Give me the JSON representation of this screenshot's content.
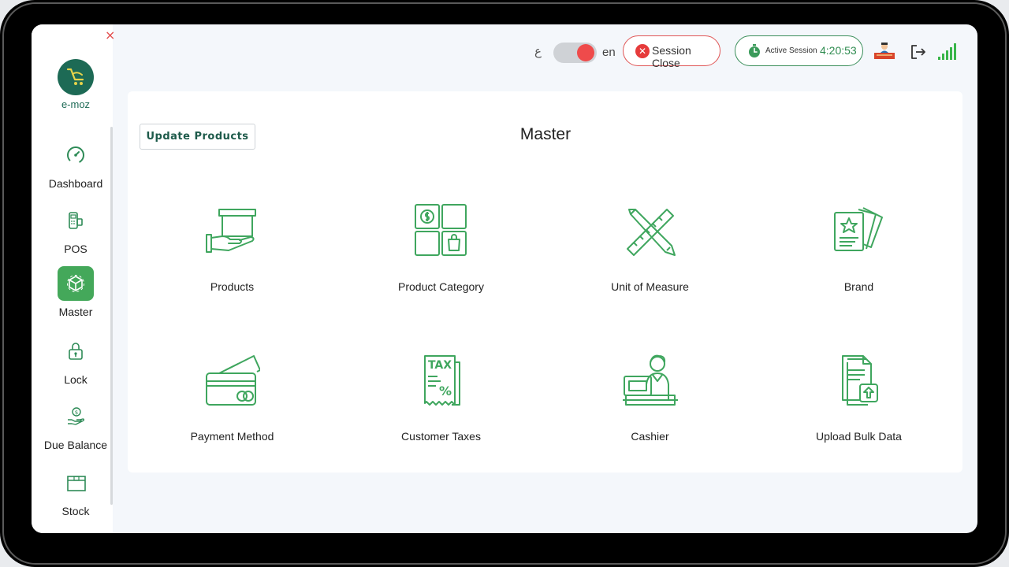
{
  "sidebar": {
    "close_glyph": "×",
    "logo_text": "e-moz",
    "items": [
      {
        "label": "Dashboard",
        "icon": "dashboard-gauge-icon"
      },
      {
        "label": "POS",
        "icon": "pos-terminal-icon"
      },
      {
        "label": "Master",
        "icon": "master-cube-icon",
        "active": true
      },
      {
        "label": "Lock",
        "icon": "lock-icon"
      },
      {
        "label": "Due Balance",
        "icon": "due-balance-icon"
      },
      {
        "label": "Stock",
        "icon": "stock-box-icon"
      }
    ]
  },
  "header": {
    "lang_ar": "ع",
    "lang_en": "en",
    "session_close_label": "Session Close",
    "session_close_glyph": "✕",
    "active_session_label": "Active Session",
    "active_session_time": "4:20:53"
  },
  "main": {
    "title": "Master",
    "update_button": "Update Products",
    "tiles": [
      {
        "label": "Products",
        "icon": "products-box-hand-icon"
      },
      {
        "label": "Product Category",
        "icon": "product-category-grid-icon"
      },
      {
        "label": "Unit of Measure",
        "icon": "unit-of-measure-ruler-icon"
      },
      {
        "label": "Brand",
        "icon": "brand-cards-icon"
      },
      {
        "label": "Payment Method",
        "icon": "payment-cards-icon"
      },
      {
        "label": "Customer Taxes",
        "icon": "customer-taxes-icon"
      },
      {
        "label": "Cashier",
        "icon": "cashier-icon"
      },
      {
        "label": "Upload Bulk Data",
        "icon": "upload-bulk-data-icon"
      }
    ]
  },
  "colors": {
    "brand_green": "#1d6a55",
    "icon_green": "#3fa65e",
    "active_nav_bg": "#44a85a",
    "danger": "#e63b3b"
  }
}
